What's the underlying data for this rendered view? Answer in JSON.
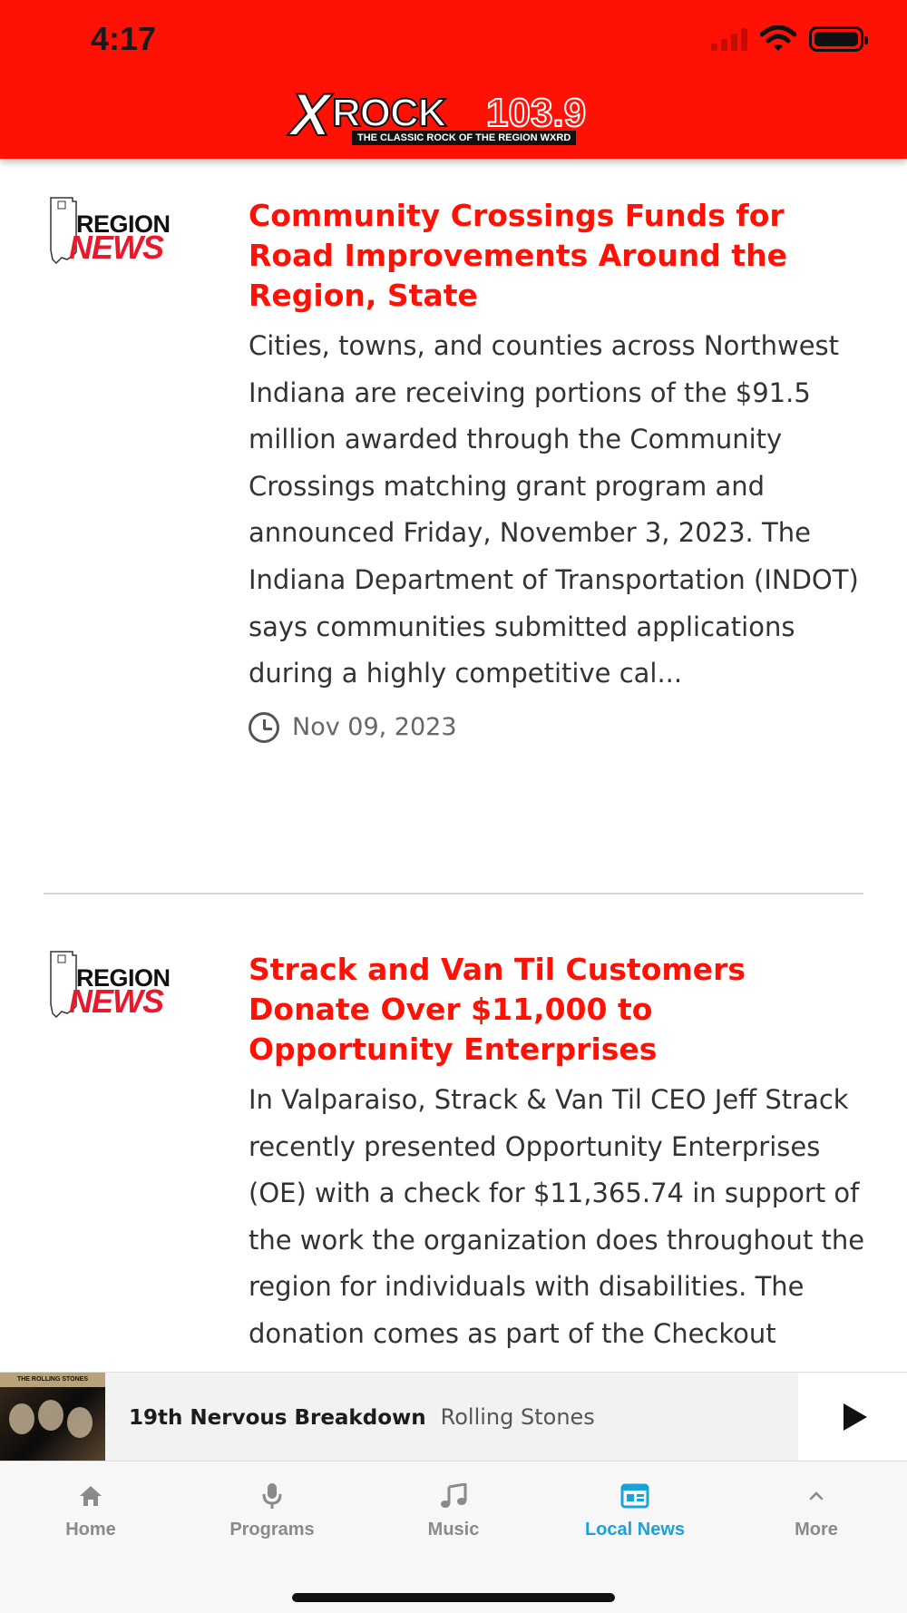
{
  "status_bar": {
    "time": "4:17"
  },
  "header": {
    "logo_x": "X",
    "logo_rock": "ROCK",
    "logo_frequency": "103.9",
    "logo_tagline": "THE CLASSIC ROCK OF THE REGION WXRD"
  },
  "articles": [
    {
      "thumb_top": "REGION",
      "thumb_bottom": "NEWS",
      "title": "Community Crossings Funds for Road Improvements Around the Region, State",
      "summary": "Cities, towns, and counties across Northwest Indiana are receiving portions of the $91.5 million awarded through the Community Crossings matching grant program and announced Friday, November 3, 2023. The Indiana Department of Transportation (INDOT) says communities submitted applications during a highly competitive cal...",
      "date": "Nov 09, 2023"
    },
    {
      "thumb_top": "REGION",
      "thumb_bottom": "NEWS",
      "title": "Strack and Van Til Customers Donate Over $11,000 to Opportunity Enterprises",
      "summary": "In Valparaiso, Strack & Van Til CEO Jeff Strack recently presented Opportunity Enterprises (OE) with a check for $11,365.74 in support of the work the organization does throughout the region for individuals with disabilities. The donation comes as part of the Checkout"
    }
  ],
  "now_playing": {
    "album_band": "THE ROLLING STONES",
    "track_title": "19th Nervous Breakdown",
    "artist": "Rolling Stones"
  },
  "tabbar": {
    "items": [
      {
        "label": "Home",
        "icon": "home-icon",
        "active": false
      },
      {
        "label": "Programs",
        "icon": "microphone-icon",
        "active": false
      },
      {
        "label": "Music",
        "icon": "music-note-icon",
        "active": false
      },
      {
        "label": "Local News",
        "icon": "newspaper-icon",
        "active": true
      },
      {
        "label": "More",
        "icon": "chevron-up-icon",
        "active": false
      }
    ],
    "active_color": "#1aa3d8",
    "inactive_color": "#8a8a8a"
  },
  "colors": {
    "brand_red": "#ff1205",
    "region_news_red": "#e8192c"
  }
}
